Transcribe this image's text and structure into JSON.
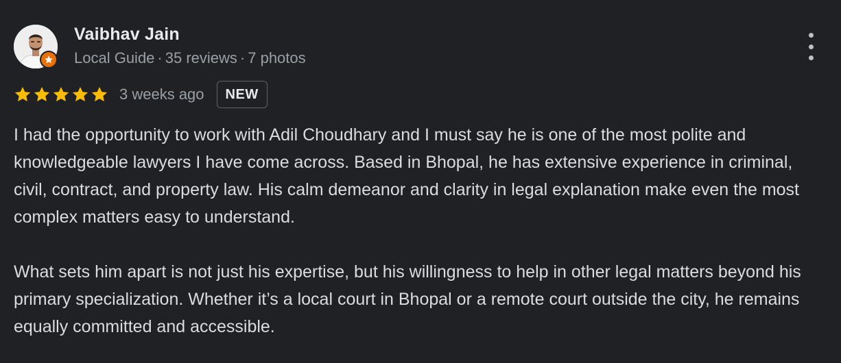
{
  "reviewer": {
    "name": "Vaibhav Jain",
    "role": "Local Guide",
    "reviews": "35 reviews",
    "photos": "7 photos",
    "separator": "·",
    "avatar_icon": "person-avatar-icon",
    "badge_icon": "local-guide-star-icon"
  },
  "rating": {
    "stars": 5,
    "max_stars": 5,
    "star_color": "#fbbc04",
    "time_ago": "3 weeks ago",
    "badge": "NEW"
  },
  "review_text": {
    "paragraph1": "I had the opportunity to work with Adil Choudhary and I must say he is one of the most polite and knowledgeable lawyers I have come across. Based in Bhopal, he has extensive experience in criminal, civil, contract, and property law. His calm demeanor and clarity in legal explanation make even the most complex matters easy to understand.",
    "paragraph2": "What sets him apart is not just his expertise, but his willingness to help in other legal matters beyond his primary specialization. Whether it’s a local court in Bhopal or a remote court outside the city, he remains equally committed and accessible."
  },
  "colors": {
    "background": "#202124",
    "badge_orange": "#e8710a",
    "secondary_text": "#9aa0a6"
  }
}
